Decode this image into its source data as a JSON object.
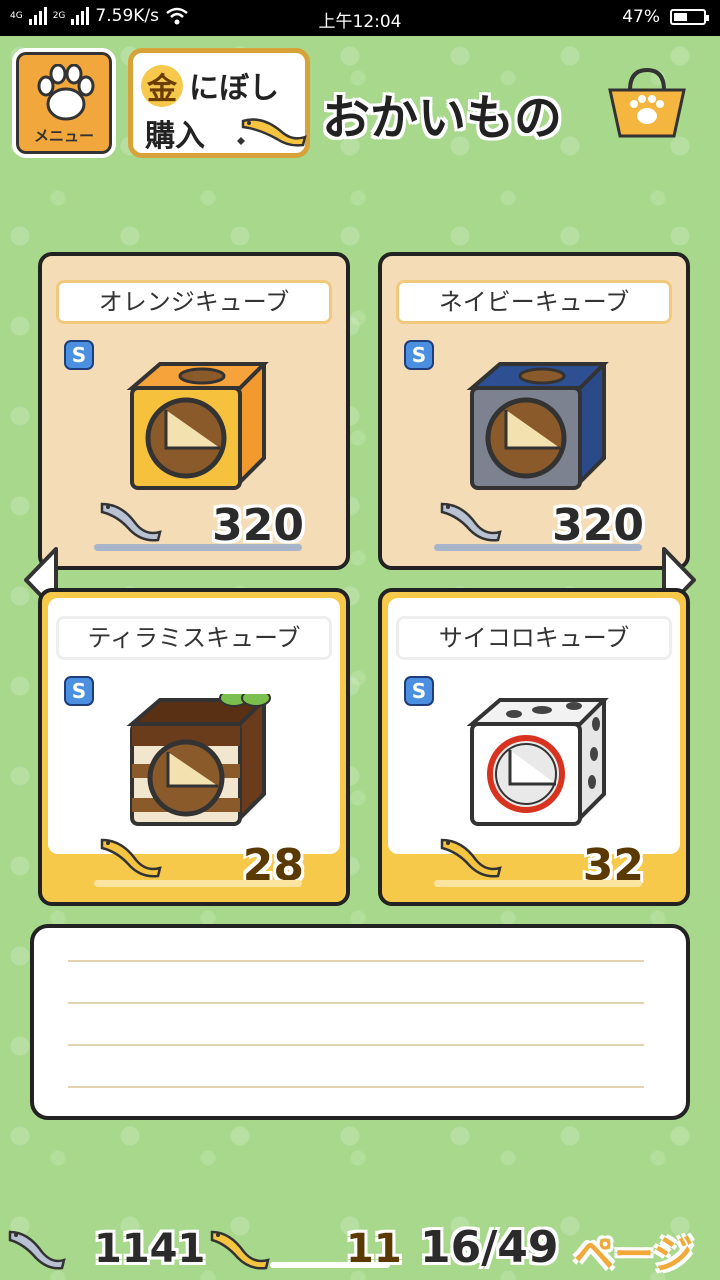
{
  "status_bar": {
    "network_1": "4G",
    "network_2": "2G",
    "speed": "7.59K/s",
    "time": "上午12:04",
    "battery_pct": "47%",
    "battery_level": 0.47
  },
  "header": {
    "menu_label": "メニュー",
    "gold_kanji": "金",
    "gold_line1": "にぼし",
    "gold_line2": "購入",
    "title": "おかいもの"
  },
  "items": [
    {
      "name": "オレンジキューブ",
      "badge": "S",
      "price": "320",
      "currency": "niboshi"
    },
    {
      "name": "ネイビーキューブ",
      "badge": "S",
      "price": "320",
      "currency": "niboshi"
    },
    {
      "name": "ティラミスキューブ",
      "badge": "S",
      "price": "28",
      "currency": "gold-niboshi"
    },
    {
      "name": "サイコロキューブ",
      "badge": "S",
      "price": "32",
      "currency": "gold-niboshi"
    }
  ],
  "message_box": {
    "text": ""
  },
  "footer": {
    "niboshi_count": "1141",
    "gold_niboshi_count": "11",
    "page": "16/49",
    "page_suffix": "ページ"
  },
  "colors": {
    "background": "#a7d88c",
    "plain_card": "#f3dcb6",
    "gold_card": "#f7c94a",
    "badge": "#4a8fe0"
  }
}
